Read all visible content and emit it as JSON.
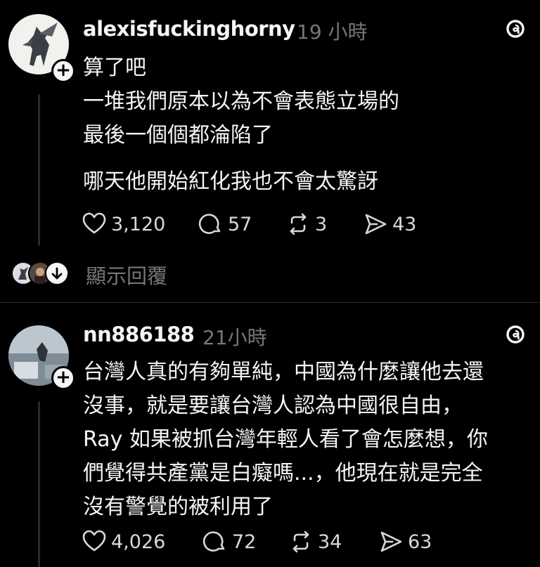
{
  "posts": [
    {
      "username": "alexisfuckinghorny",
      "time": "19 小時",
      "lines": [
        "算了吧",
        "一堆我們原本以為不會表態立場的",
        "最後一個個都淪陷了",
        "哪天他開始紅化我也不會太驚訝"
      ],
      "likes": "3,120",
      "comments": "57",
      "reposts": "3",
      "shares": "43"
    },
    {
      "username": "nn886188",
      "time": "21小時",
      "lines": [
        "台灣人真的有夠單純，中國為什麼讓他去還",
        "沒事，就是要讓台灣人認為中國很自由，",
        "Ray 如果被抓台灣年輕人看了會怎麼想，你",
        "們覺得共產黨是白癡嗎...，他現在就是完全",
        "沒有警覺的被利用了"
      ],
      "likes": "4,026",
      "comments": "72",
      "reposts": "34",
      "shares": "63"
    }
  ],
  "show_replies": "顯示回覆",
  "icons": {
    "follow": "+",
    "like": "heart-icon",
    "comment": "comment-icon",
    "repost": "repost-icon",
    "share": "share-icon",
    "threads": "threads-logo-icon",
    "expand": "arrow-down-icon"
  },
  "colors": {
    "background": "#000000",
    "text": "#f3f5f7",
    "muted": "#777777"
  }
}
